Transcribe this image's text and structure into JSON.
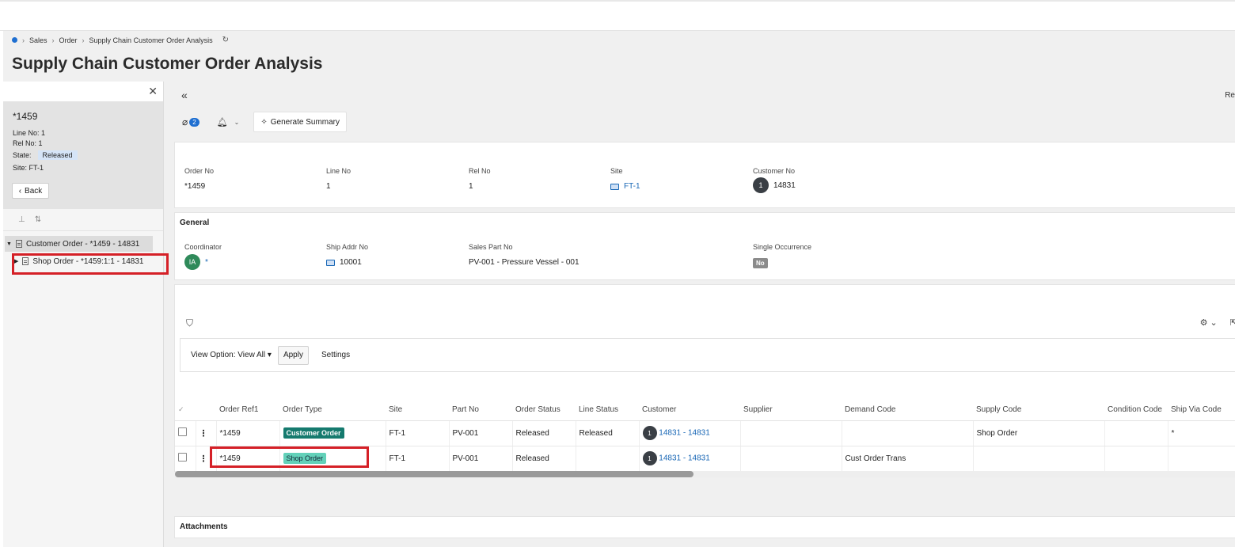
{
  "breadcrumb": {
    "items": [
      "Sales",
      "Order",
      "Supply Chain Customer Order Analysis"
    ]
  },
  "page_title": "Supply Chain Customer Order Analysis",
  "left_panel": {
    "record_id": "*1459",
    "line_no_label": "Line No:",
    "line_no": "1",
    "rel_no_label": "Rel No:",
    "rel_no": "1",
    "state_label": "State:",
    "state": "Released",
    "site_label": "Site:",
    "site": "FT-1",
    "back_label": "Back",
    "tree": [
      {
        "label": "Customer Order - *1459 - 14831"
      },
      {
        "label": "Shop Order - *1459:1:1 - 14831"
      }
    ]
  },
  "toolbar": {
    "attachments_count": "2",
    "generate_summary": "Generate Summary",
    "re_label": "Re"
  },
  "header_fields": {
    "order_no": {
      "label": "Order No",
      "value": "*1459"
    },
    "line_no": {
      "label": "Line No",
      "value": "1"
    },
    "rel_no": {
      "label": "Rel No",
      "value": "1"
    },
    "site": {
      "label": "Site",
      "value": "FT-1"
    },
    "customer_no": {
      "label": "Customer No",
      "value": "14831",
      "badge": "1"
    }
  },
  "general": {
    "title": "General",
    "coordinator": {
      "label": "Coordinator",
      "initials": "IA",
      "value": "*"
    },
    "ship_addr_no": {
      "label": "Ship Addr No",
      "value": "10001"
    },
    "sales_part_no": {
      "label": "Sales Part No",
      "value": "PV-001 - Pressure Vessel - 001"
    },
    "single_occurrence": {
      "label": "Single Occurrence",
      "value": "No"
    }
  },
  "grid": {
    "view_option": "View Option: View All",
    "apply": "Apply",
    "settings": "Settings",
    "columns": [
      "Order Ref1",
      "Order Type",
      "Site",
      "Part No",
      "Order Status",
      "Line Status",
      "Customer",
      "Supplier",
      "Demand Code",
      "Supply Code",
      "Condition Code",
      "Ship Via Code"
    ],
    "rows": [
      {
        "order_ref1": "*1459",
        "order_type": "Customer Order",
        "site": "FT-1",
        "part_no": "PV-001",
        "order_status": "Released",
        "line_status": "Released",
        "customer_badge": "1",
        "customer": "14831 - 14831",
        "supplier": "",
        "demand_code": "",
        "supply_code": "Shop Order",
        "condition_code": "",
        "ship_via_code": "*"
      },
      {
        "order_ref1": "*1459",
        "order_type": "Shop Order",
        "site": "FT-1",
        "part_no": "PV-001",
        "order_status": "Released",
        "line_status": "",
        "customer_badge": "1",
        "customer": "14831 - 14831",
        "supplier": "",
        "demand_code": "Cust Order Trans",
        "supply_code": "",
        "condition_code": "",
        "ship_via_code": ""
      }
    ]
  },
  "attachments_title": "Attachments",
  "colors": {
    "accent": "#1f6fd1",
    "link": "#1766b5",
    "customer_order_badge": "#157a6e",
    "shop_order_badge": "#63d1b9",
    "highlight": "#d52027"
  }
}
